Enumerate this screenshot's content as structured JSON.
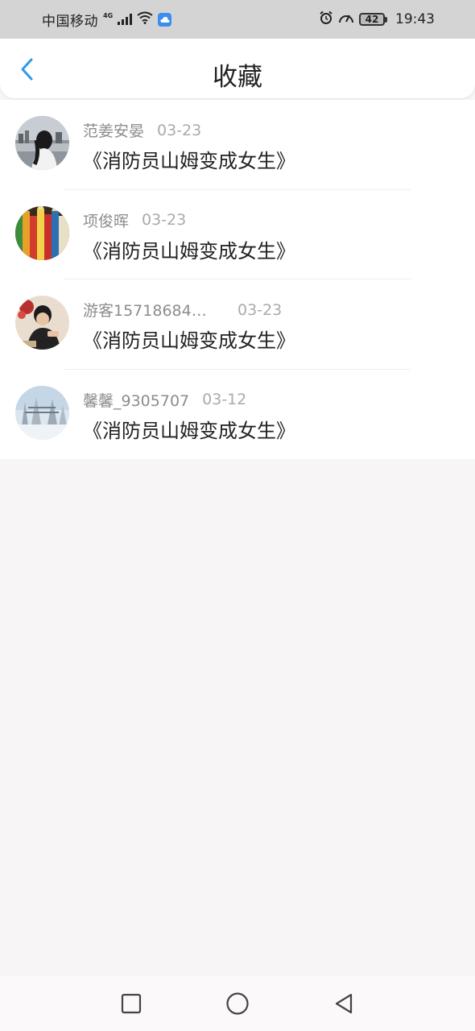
{
  "status_bar": {
    "carrier": "中国移动",
    "network": "4G",
    "battery": "42",
    "time": "19:43"
  },
  "header": {
    "title": "收藏",
    "back_icon": "chevron-left-icon"
  },
  "favorites": [
    {
      "user": "范姜安晏",
      "date": "03-23",
      "title": "《消防员山姆变成女生》"
    },
    {
      "user": "项俊晖",
      "date": "03-23",
      "title": "《消防员山姆变成女生》"
    },
    {
      "user": "游客15718684…",
      "date": "03-23",
      "title": "《消防员山姆变成女生》"
    },
    {
      "user": "馨馨_9305707",
      "date": "03-12",
      "title": "《消防员山姆变成女生》"
    }
  ],
  "colors": {
    "accent": "#2f9ae6",
    "status_bar_bg": "#d4d4d4",
    "page_bg": "#f7f5f6"
  },
  "nav_bar": {
    "recent_icon": "square-icon",
    "home_icon": "circle-icon",
    "back_icon": "triangle-back-icon"
  }
}
